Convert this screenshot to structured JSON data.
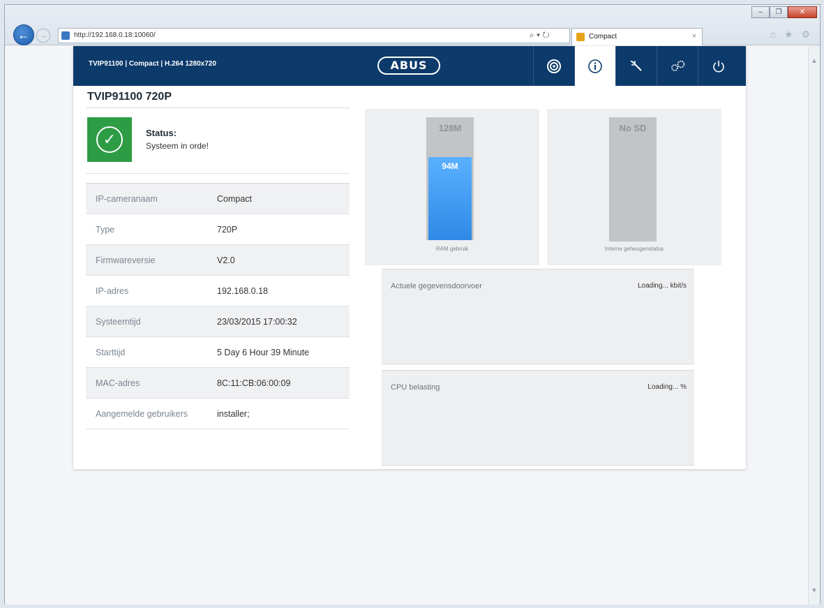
{
  "browser": {
    "url": "http://192.168.0.18:10060/",
    "tab_title": "Compact",
    "tab_close": "×",
    "search_refresh": "⌕ ▾ ↻",
    "nav_icons": "⌂ ★ ⚙",
    "window_buttons": {
      "minimize": "–",
      "restore": "❐",
      "close": "✕"
    }
  },
  "header": {
    "device_title": "TVIP91100 | Compact | H.264 1280x720",
    "logo": "ABUS",
    "nav": [
      {
        "name": "live-view",
        "icon": "camera-icon"
      },
      {
        "name": "info",
        "icon": "info-icon",
        "active": true
      },
      {
        "name": "wizard",
        "icon": "wand-icon"
      },
      {
        "name": "settings",
        "icon": "gears-icon"
      },
      {
        "name": "logout",
        "icon": "power-icon"
      }
    ]
  },
  "main": {
    "title": "TVIP91100 720P",
    "status_label": "Status:",
    "status_value": "Systeem in orde!",
    "status_color": "#2e9c45",
    "rows": [
      {
        "label": "IP-cameranaam",
        "value": "Compact"
      },
      {
        "label": "Type",
        "value": "720P"
      },
      {
        "label": "Firmwareversie",
        "value": "V2.0"
      },
      {
        "label": "IP-adres",
        "value": "192.168.0.18"
      },
      {
        "label": "Systeemtijd",
        "value": "23/03/2015 17:00:32"
      },
      {
        "label": "Starttijd",
        "value": "5 Day 6 Hour 39 Minute"
      },
      {
        "label": "MAC-adres",
        "value": "8C:11:CB:06:00:09"
      },
      {
        "label": "Aangemelde gebruikers",
        "value": "installer;"
      }
    ]
  },
  "ram": {
    "total": "128M",
    "used": "94M",
    "used_fraction": 0.734,
    "caption": "RAM gebruik"
  },
  "storage": {
    "status": "No SD",
    "caption": "Interne geheugenstatus"
  },
  "throughput": {
    "label": "Actuele gegevensdoorvoer",
    "value": "Loading... kbit/s"
  },
  "cpu": {
    "label": "CPU belasting",
    "value": "Loading... %"
  },
  "colors": {
    "header_bg": "#0c3a6a",
    "accent_blue": "#2e8ae6"
  }
}
